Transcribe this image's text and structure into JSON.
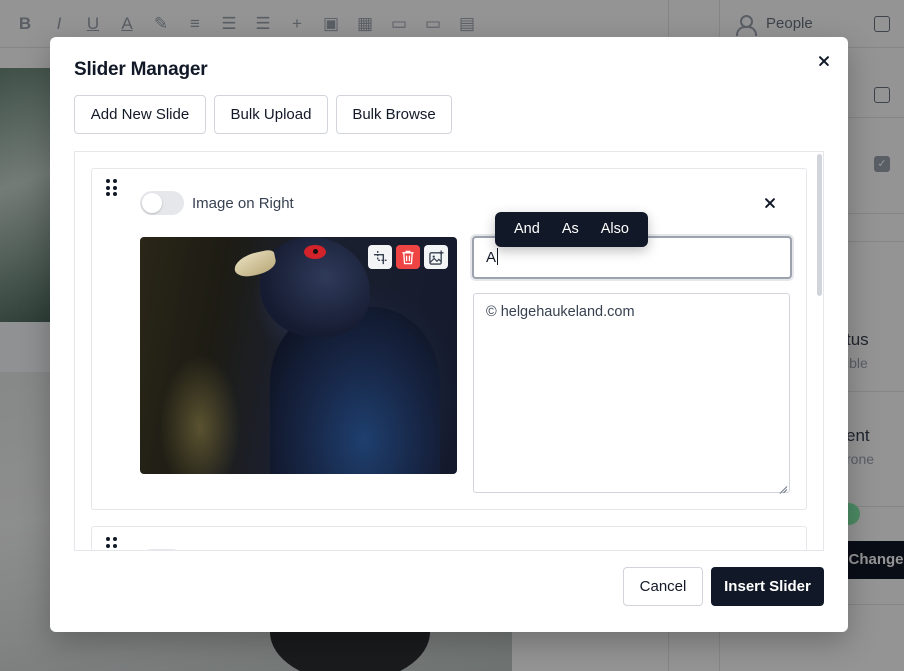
{
  "background": {
    "sidebar": {
      "people_label": "People",
      "status_label": "tus",
      "status_sub": "ible",
      "assignee_label": "ent",
      "assignee_sub": "rone",
      "save_button_label": "e Changes"
    },
    "toolbar_icons": [
      "bold-icon",
      "italic-icon",
      "underline-icon",
      "text-color-icon",
      "highlight-icon",
      "align-icon",
      "ordered-list-icon",
      "bullet-list-icon",
      "plus-icon",
      "image-icon",
      "gallery-icon",
      "embed-icon",
      "video-icon",
      "document-icon"
    ]
  },
  "modal": {
    "title": "Slider Manager",
    "buttons": {
      "add_new_slide": "Add New Slide",
      "bulk_upload": "Bulk Upload",
      "bulk_browse": "Bulk Browse",
      "cancel": "Cancel",
      "insert_slider": "Insert Slider"
    },
    "slides": [
      {
        "toggle_label": "Image on Right",
        "toggle_on": false,
        "title_value": "A",
        "description": "© helgehaukeland.com",
        "image_actions": [
          "crop-icon",
          "trash-icon",
          "replace-image-icon"
        ]
      }
    ],
    "autocomplete_suggestions": [
      "And",
      "As",
      "Also"
    ]
  },
  "colors": {
    "primary": "#111827",
    "danger": "#ef4444",
    "border": "#d1d5db"
  }
}
